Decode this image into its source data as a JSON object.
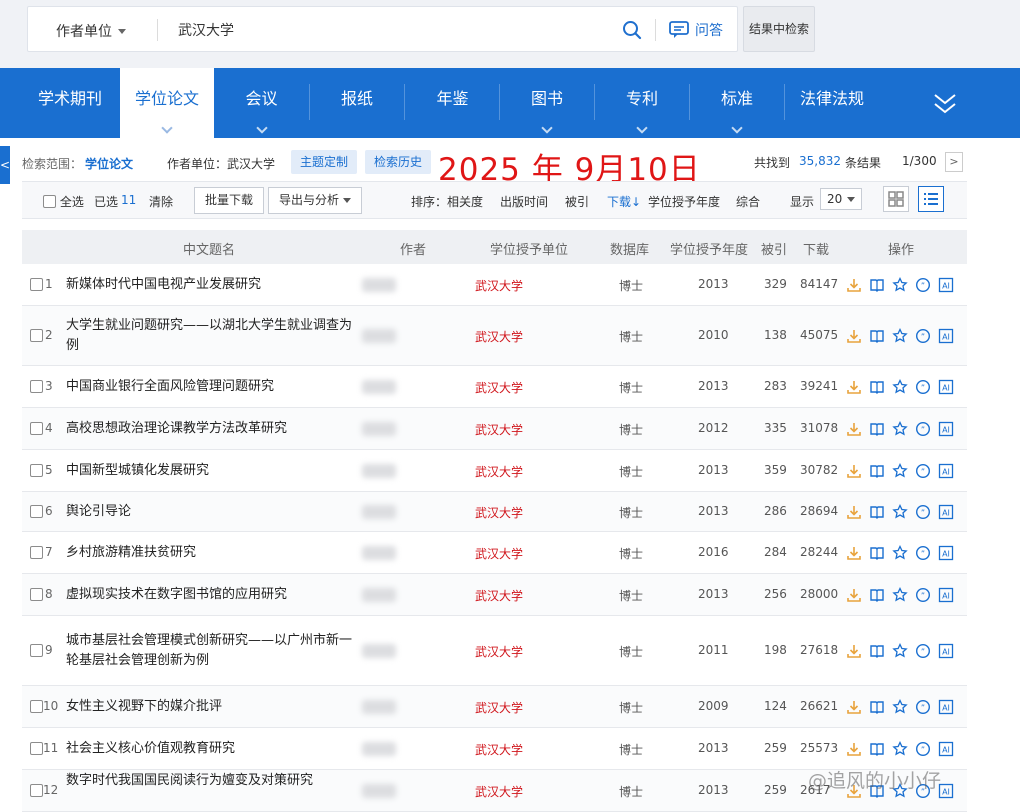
{
  "search": {
    "field": "作者单位",
    "query": "武汉大学",
    "qa_label": "问答",
    "within_label": "结果中检索"
  },
  "nav": {
    "items": [
      {
        "label": "学术期刊",
        "dropdown": false
      },
      {
        "label": "学位论文",
        "dropdown": true,
        "active": true
      },
      {
        "label": "会议",
        "dropdown": true
      },
      {
        "label": "报纸",
        "dropdown": false
      },
      {
        "label": "年鉴",
        "dropdown": false
      },
      {
        "label": "图书",
        "dropdown": true
      },
      {
        "label": "专利",
        "dropdown": true
      },
      {
        "label": "标准",
        "dropdown": true
      },
      {
        "label": "法律法规",
        "dropdown": false
      }
    ]
  },
  "scope": {
    "left_tab": "<",
    "label": "检索范围：",
    "value": "学位论文",
    "author_unit": "作者单位：武汉大学",
    "chip1": "主题定制",
    "chip2": "检索历史",
    "date_stamp": "2025 年 9月10日",
    "found_label": "共找到",
    "found_count": "35,832",
    "found_unit": "条结果",
    "page": "1/300",
    "next": ">"
  },
  "toolbar": {
    "select_all": "全选",
    "selected": "已选",
    "selected_count": "11",
    "clear": "清除",
    "batch_download": "批量下载",
    "export": "导出与分析",
    "sort_label": "排序：相关度",
    "sort_pubtime": "出版时间",
    "sort_cited": "被引",
    "sort_download": "下载",
    "sort_download_arrow": "↓",
    "sort_degree_year": "学位授予年度",
    "sort_overall": "综合",
    "display_label": "显示",
    "display_count": "20"
  },
  "table": {
    "headers": {
      "title": "中文题名",
      "author": "作者",
      "unit": "学位授予单位",
      "db": "数据库",
      "year": "学位授予年度",
      "cited": "被引",
      "downloads": "下载",
      "ops": "操作"
    },
    "rows": [
      {
        "no": "1",
        "title": "新媒体时代中国电视产业发展研究",
        "unit": "武汉大学",
        "db": "博士",
        "year": "2013",
        "cited": "329",
        "downloads": "84147"
      },
      {
        "no": "2",
        "title": "大学生就业问题研究——以湖北大学生就业调查为例",
        "unit": "武汉大学",
        "db": "博士",
        "year": "2010",
        "cited": "138",
        "downloads": "45075"
      },
      {
        "no": "3",
        "title": "中国商业银行全面风险管理问题研究",
        "unit": "武汉大学",
        "db": "博士",
        "year": "2013",
        "cited": "283",
        "downloads": "39241"
      },
      {
        "no": "4",
        "title": "高校思想政治理论课教学方法改革研究",
        "unit": "武汉大学",
        "db": "博士",
        "year": "2012",
        "cited": "335",
        "downloads": "31078"
      },
      {
        "no": "5",
        "title": "中国新型城镇化发展研究",
        "unit": "武汉大学",
        "db": "博士",
        "year": "2013",
        "cited": "359",
        "downloads": "30782"
      },
      {
        "no": "6",
        "title": "舆论引导论",
        "unit": "武汉大学",
        "db": "博士",
        "year": "2013",
        "cited": "286",
        "downloads": "28694"
      },
      {
        "no": "7",
        "title": "乡村旅游精准扶贫研究",
        "unit": "武汉大学",
        "db": "博士",
        "year": "2016",
        "cited": "284",
        "downloads": "28244"
      },
      {
        "no": "8",
        "title": "虚拟现实技术在数字图书馆的应用研究",
        "unit": "武汉大学",
        "db": "博士",
        "year": "2013",
        "cited": "256",
        "downloads": "28000"
      },
      {
        "no": "9",
        "title": "城市基层社会管理模式创新研究——以广州市新一轮基层社会管理创新为例",
        "unit": "武汉大学",
        "db": "博士",
        "year": "2011",
        "cited": "198",
        "downloads": "27618"
      },
      {
        "no": "10",
        "title": "女性主义视野下的媒介批评",
        "unit": "武汉大学",
        "db": "博士",
        "year": "2009",
        "cited": "124",
        "downloads": "26621"
      },
      {
        "no": "11",
        "title": "社会主义核心价值观教育研究",
        "unit": "武汉大学",
        "db": "博士",
        "year": "2013",
        "cited": "259",
        "downloads": "25573"
      },
      {
        "no": "12",
        "title": "数字时代我国国民阅读行为嬗变及对策研究",
        "unit": "武汉大学",
        "db": "博士",
        "year": "2013",
        "cited": "259",
        "downloads": "2617"
      }
    ]
  },
  "watermark": "@追风的小小仔",
  "colors": {
    "nav_bg": "#1a6fd0",
    "accent": "#1a6fd0",
    "unit_red": "#d0151b",
    "date_red": "#e01616",
    "download_icon": "#e8a33d"
  }
}
